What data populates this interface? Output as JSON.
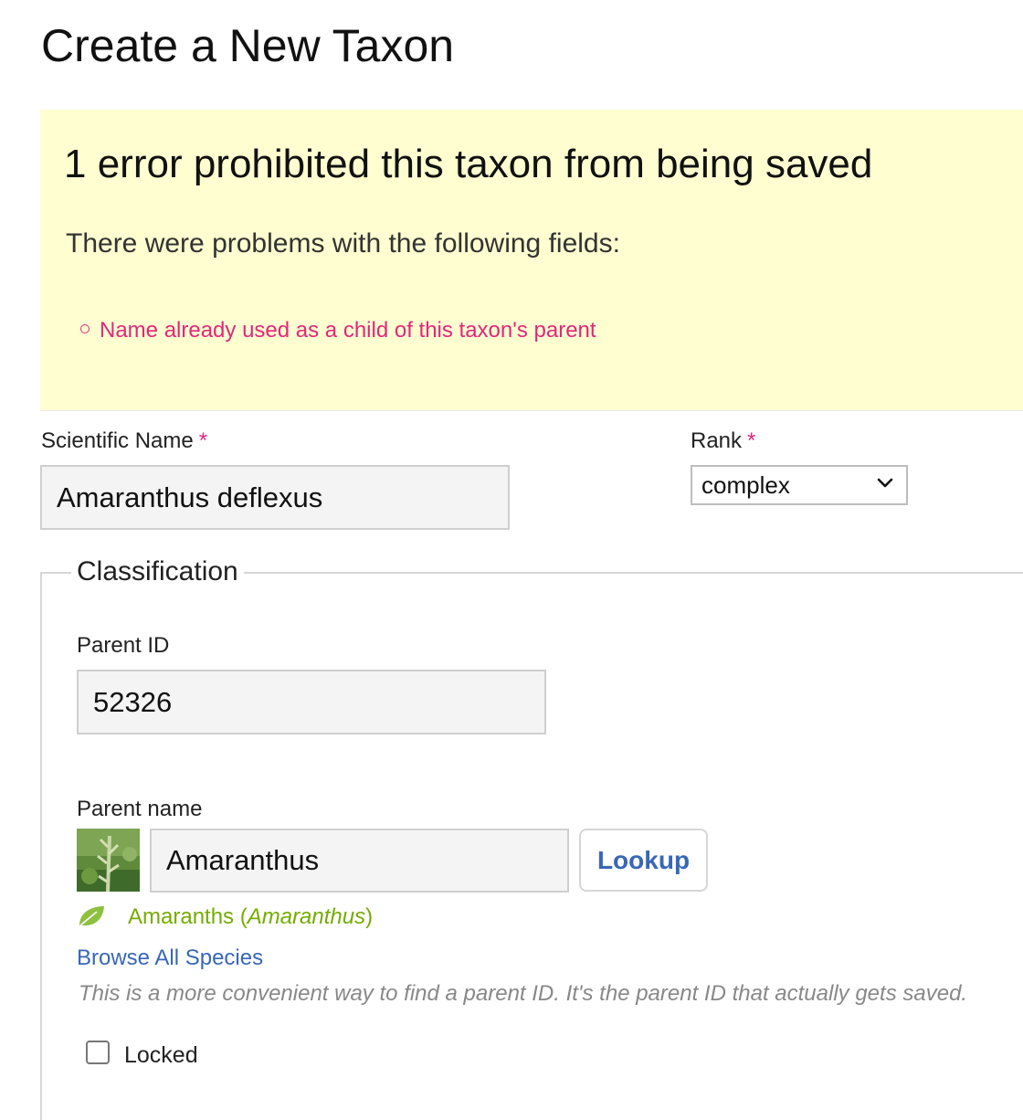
{
  "page": {
    "title": "Create a New Taxon"
  },
  "errors": {
    "heading": "1 error prohibited this taxon from being saved",
    "intro": "There were problems with the following fields:",
    "items": [
      "Name already used as a child of this taxon's parent"
    ]
  },
  "form": {
    "scientific_name": {
      "label": "Scientific Name",
      "required_mark": "*",
      "value": "Amaranthus deflexus"
    },
    "rank": {
      "label": "Rank",
      "required_mark": "*",
      "selected": "complex"
    },
    "classification": {
      "legend": "Classification",
      "parent_id": {
        "label": "Parent ID",
        "value": "52326"
      },
      "parent_name": {
        "label": "Parent name",
        "value": "Amaranthus",
        "lookup_label": "Lookup",
        "taxon_common": "Amaranths (",
        "taxon_scientific": "Amaranthus",
        "taxon_close": ")",
        "iconic_icon": "plant-leaf-icon"
      },
      "browse_link": "Browse All Species",
      "hint": "This is a more convenient way to find a parent ID. It's the parent ID that actually gets saved.",
      "locked": {
        "label": "Locked",
        "checked": false
      }
    }
  },
  "colors": {
    "error_bg": "#fefed0",
    "error_text": "#e0287c",
    "link": "#3867b7",
    "taxon_green": "#74ac00"
  }
}
